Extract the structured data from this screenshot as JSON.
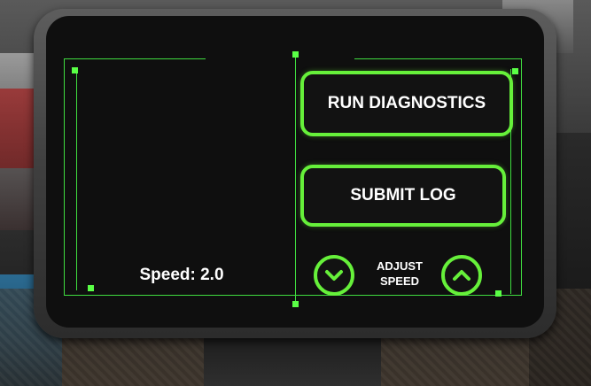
{
  "panel": {
    "speed_readout": "Speed: 2.0",
    "run_diagnostics_label": "RUN DIAGNOSTICS",
    "submit_log_label": "SUBMIT LOG",
    "adjust_speed_line1": "ADJUST",
    "adjust_speed_line2": "SPEED",
    "decrease_icon": "chevron-down-icon",
    "increase_icon": "chevron-up-icon"
  },
  "colors": {
    "accent": "#66f03a",
    "screen": "#0f0f0f",
    "text": "#ffffff"
  }
}
